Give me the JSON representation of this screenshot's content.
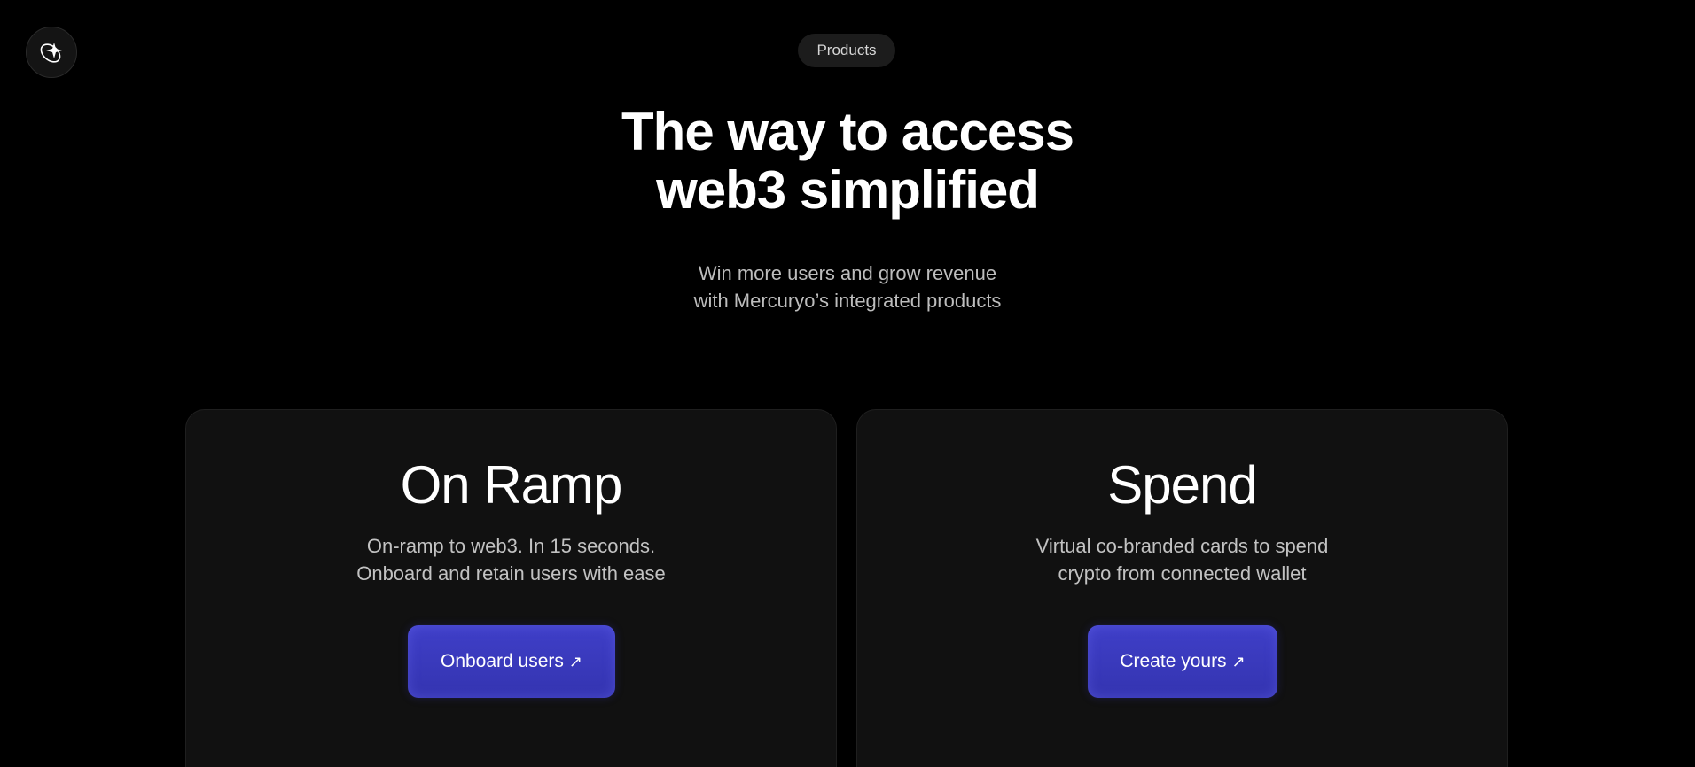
{
  "logo": {
    "icon": "sparkle-logo-icon"
  },
  "header": {
    "pill_label": "Products"
  },
  "hero": {
    "title_line1": "The way to access",
    "title_line2": "web3 simplified",
    "subtitle_line1": "Win more users and grow revenue",
    "subtitle_line2": "with Mercuryo’s integrated products"
  },
  "cards": [
    {
      "title": "On Ramp",
      "desc_line1": "On-ramp to web3. In 15 seconds.",
      "desc_line2": "Onboard and retain users with ease",
      "cta_label": "Onboard users",
      "cta_icon": "arrow-up-right-icon"
    },
    {
      "title": "Spend",
      "desc_line1": "Virtual co-branded cards to spend",
      "desc_line2": "crypto from connected wallet",
      "cta_label": "Create yours",
      "cta_icon": "arrow-up-right-icon"
    }
  ],
  "colors": {
    "background": "#000000",
    "card_background": "#111111",
    "accent": "#3a3abf"
  }
}
